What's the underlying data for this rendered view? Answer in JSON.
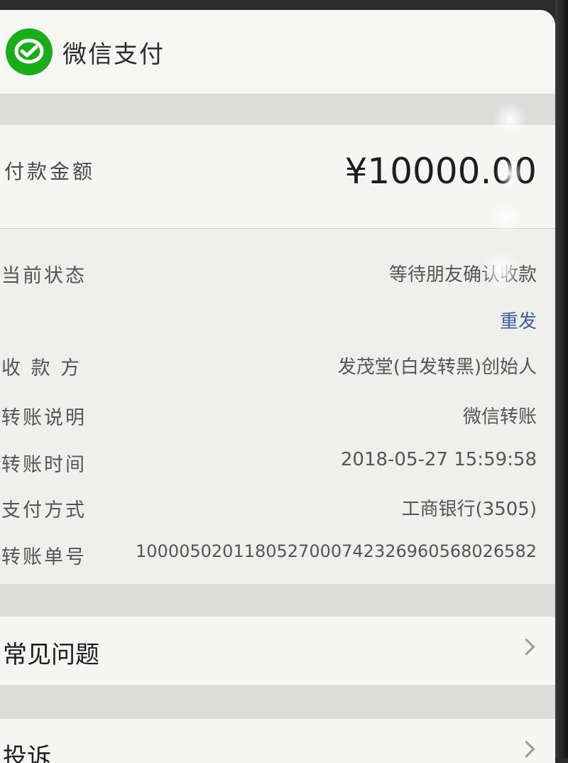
{
  "header": {
    "title": "微信支付",
    "logo_icon": "wechat-pay-icon",
    "brand_color": "#1aad19"
  },
  "payment": {
    "amount_label": "付款金额",
    "amount": "¥10000.00"
  },
  "details": [
    {
      "key": "当前状态",
      "value": "等待朋友确认收款"
    },
    {
      "key": "收 款 方",
      "value": "发茂堂(白发转黑)创始人"
    },
    {
      "key": "转账说明",
      "value": "微信转账"
    },
    {
      "key": "转账时间",
      "value": "2018-05-27 15:59:58"
    },
    {
      "key": "支付方式",
      "value": "工商银行(3505)"
    },
    {
      "key": "转账单号",
      "value": "1000050201180527000742326960568026582"
    }
  ],
  "resend_label": "重发",
  "menu": [
    {
      "label": "常见问题",
      "icon": "chevron-right-icon"
    },
    {
      "label": "投诉",
      "icon": "chevron-right-icon"
    }
  ],
  "colors": {
    "link": "#3d5f95",
    "background": "#f1f1ef"
  }
}
